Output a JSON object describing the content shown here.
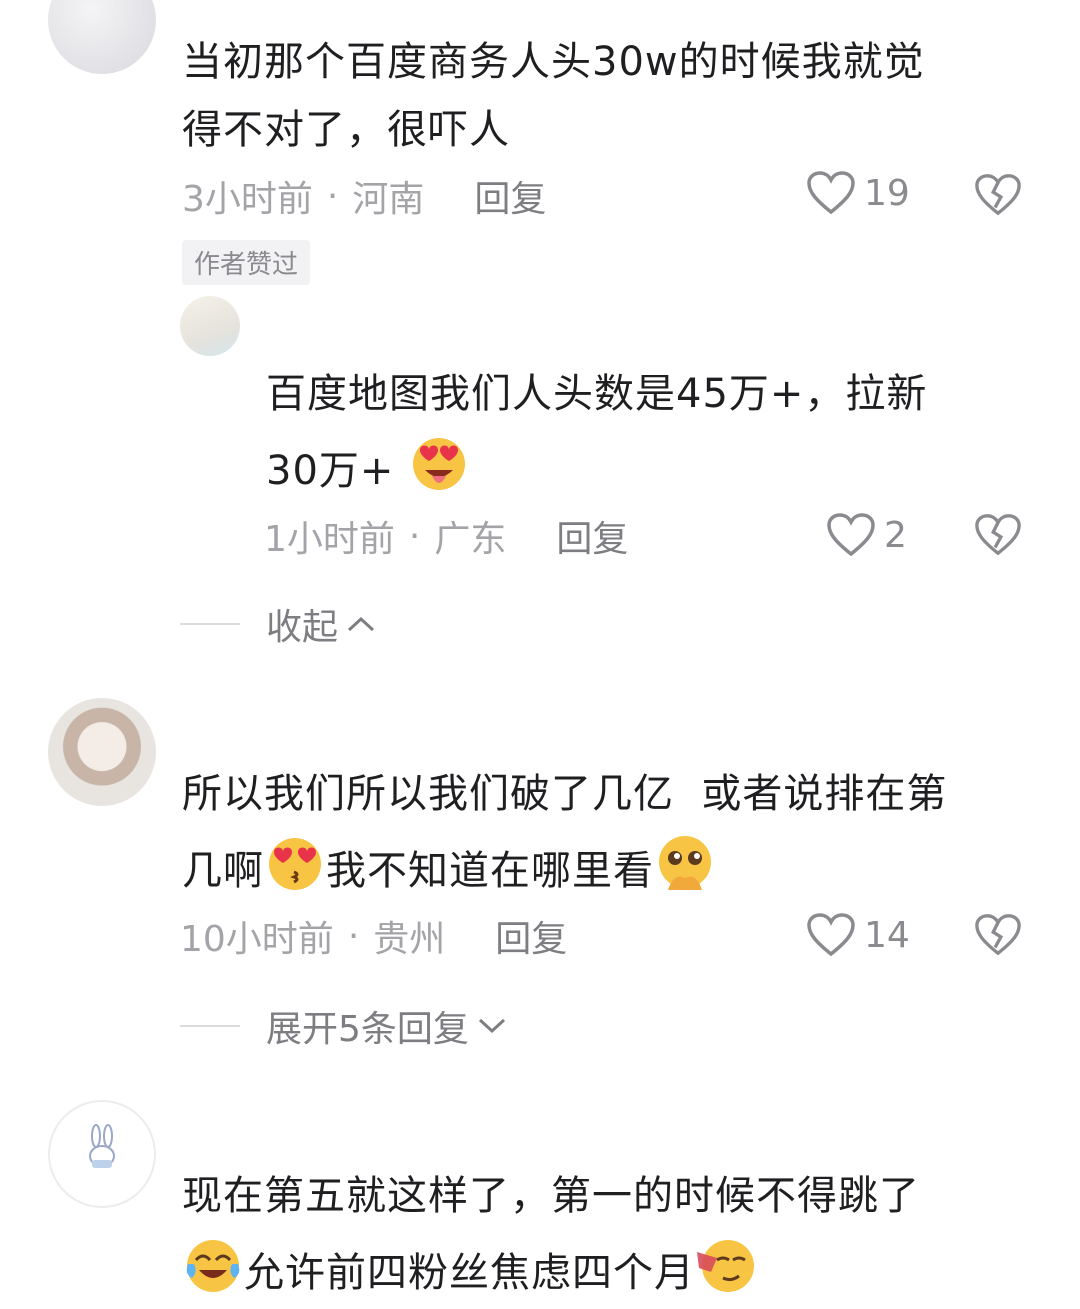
{
  "comments": [
    {
      "text_line1": "当初那个百度商务人头30w的时候我就觉",
      "text_line2": "得不对了，很吓人",
      "time": "3小时前",
      "location": "河南",
      "reply": "回复",
      "likes": "19",
      "badge": "作者赞过",
      "sub_reply": {
        "text_line1": "百度地图我们人头数是45万+，拉新",
        "text_line2": "30万+",
        "time": "1小时前",
        "location": "广东",
        "reply": "回复",
        "likes": "2"
      },
      "toggle": "收起"
    },
    {
      "text_line1": "所以我们所以我们破了几亿  或者说排在第",
      "text_line2a": "几啊",
      "text_line2b": "我不知道在哪里看",
      "time": "10小时前",
      "location": "贵州",
      "reply": "回复",
      "likes": "14",
      "toggle": "展开5条回复"
    },
    {
      "text_line1": "现在第五就这样了，第一的时候不得跳了",
      "text_line2": "允许前四粉丝焦虑四个月"
    }
  ],
  "separator": "·",
  "colors": {
    "meta": "#a3a3a8",
    "text": "#1f1f22",
    "icon": "#8a8a8f"
  }
}
